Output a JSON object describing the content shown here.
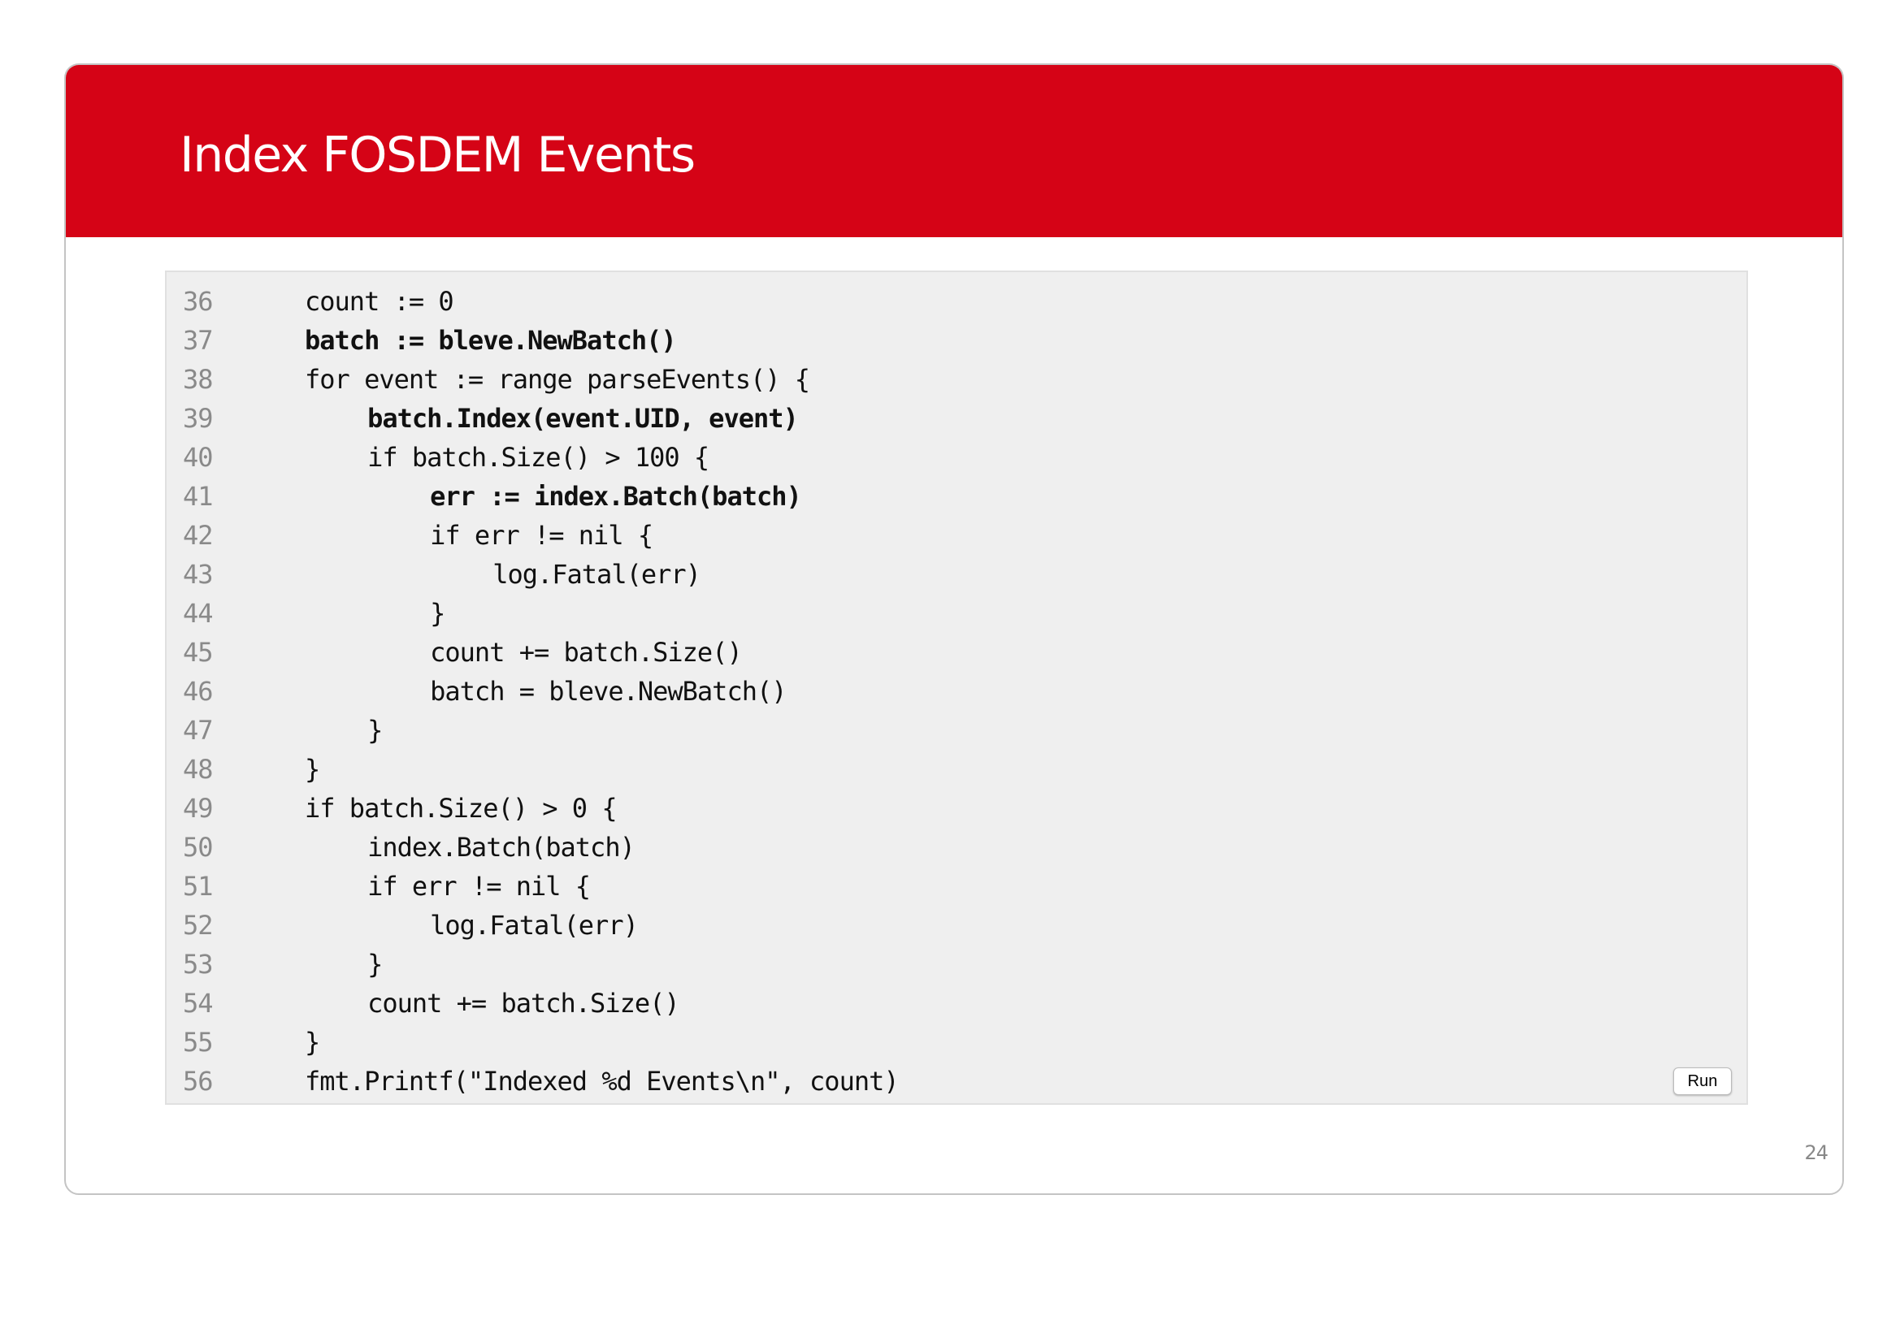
{
  "slide": {
    "title": "Index FOSDEM Events",
    "page_number": "24",
    "header_color": "#d50316",
    "run_label": "Run"
  },
  "code": {
    "lines": [
      {
        "n": "36",
        "text": "count := 0",
        "indent": 1,
        "bold": false
      },
      {
        "n": "37",
        "text": "batch := bleve.NewBatch()",
        "indent": 1,
        "bold": true
      },
      {
        "n": "38",
        "text": "for event := range parseEvents() {",
        "indent": 1,
        "bold": false
      },
      {
        "n": "39",
        "text": "batch.Index(event.UID, event)",
        "indent": 2,
        "bold": true
      },
      {
        "n": "40",
        "text": "if batch.Size() > 100 {",
        "indent": 2,
        "bold": false
      },
      {
        "n": "41",
        "text": "err := index.Batch(batch)",
        "indent": 3,
        "bold": true
      },
      {
        "n": "42",
        "text": "if err != nil {",
        "indent": 3,
        "bold": false
      },
      {
        "n": "43",
        "text": "log.Fatal(err)",
        "indent": 4,
        "bold": false
      },
      {
        "n": "44",
        "text": "}",
        "indent": 3,
        "bold": false
      },
      {
        "n": "45",
        "text": "count += batch.Size()",
        "indent": 3,
        "bold": false
      },
      {
        "n": "46",
        "text": "batch = bleve.NewBatch()",
        "indent": 3,
        "bold": false
      },
      {
        "n": "47",
        "text": "}",
        "indent": 2,
        "bold": false
      },
      {
        "n": "48",
        "text": "}",
        "indent": 1,
        "bold": false
      },
      {
        "n": "49",
        "text": "if batch.Size() > 0 {",
        "indent": 1,
        "bold": false
      },
      {
        "n": "50",
        "text": "index.Batch(batch)",
        "indent": 2,
        "bold": false
      },
      {
        "n": "51",
        "text": "if err != nil {",
        "indent": 2,
        "bold": false
      },
      {
        "n": "52",
        "text": "log.Fatal(err)",
        "indent": 3,
        "bold": false
      },
      {
        "n": "53",
        "text": "}",
        "indent": 2,
        "bold": false
      },
      {
        "n": "54",
        "text": "count += batch.Size()",
        "indent": 2,
        "bold": false
      },
      {
        "n": "55",
        "text": "}",
        "indent": 1,
        "bold": false
      },
      {
        "n": "56",
        "text": "fmt.Printf(\"Indexed %d Events\\n\", count)",
        "indent": 1,
        "bold": false
      }
    ]
  }
}
